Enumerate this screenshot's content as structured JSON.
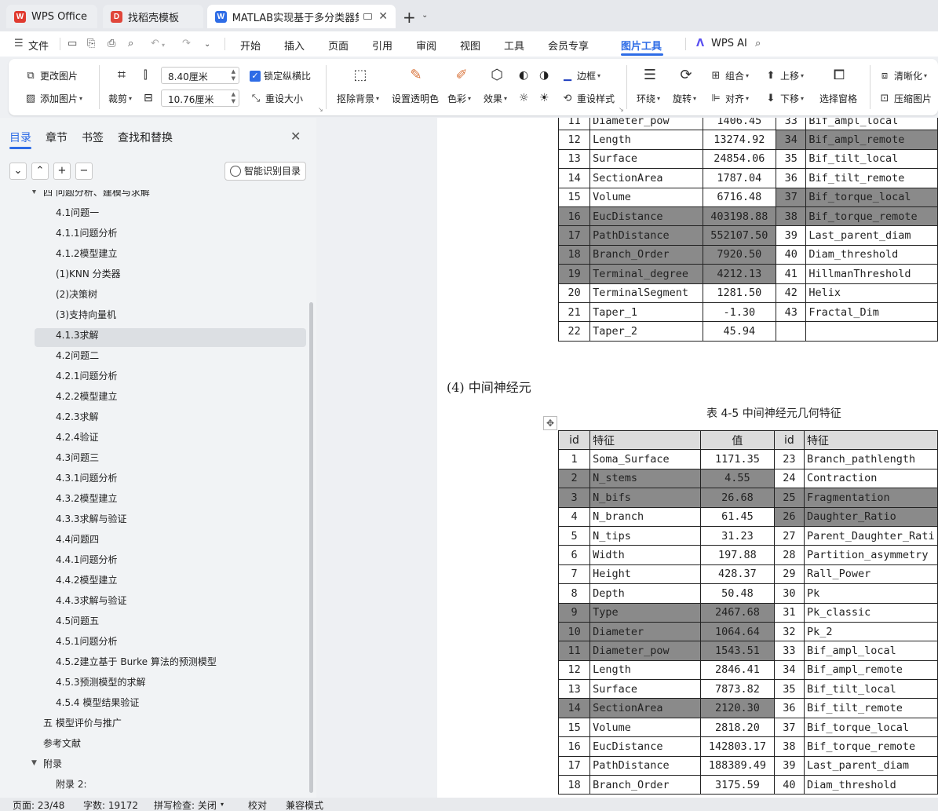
{
  "tabs": [
    {
      "label": "WPS Office"
    },
    {
      "label": "找稻壳模板"
    },
    {
      "label": "MATLAB实现基于多分类器集成"
    }
  ],
  "menu": {
    "file": "文件",
    "items": [
      "开始",
      "插入",
      "页面",
      "引用",
      "审阅",
      "视图",
      "工具",
      "会员专享",
      "图片工具"
    ],
    "wps_ai": "WPS AI"
  },
  "ribbon": {
    "change_image": "更改图片",
    "add_image": "添加图片",
    "crop": "裁剪",
    "width_value": "8.40厘米",
    "height_value": "10.76厘米",
    "lock_ratio": "锁定纵横比",
    "reset_size": "重设大小",
    "remove_bg": "抠除背景",
    "set_transparent": "设置透明色",
    "color": "色彩",
    "effect": "效果",
    "border": "边框",
    "reset_style": "重设样式",
    "wrap": "环绕",
    "rotate": "旋转",
    "group": "组合",
    "align": "对齐",
    "move_up": "上移",
    "move_down": "下移",
    "selection_pane": "选择窗格",
    "sharpen": "清晰化",
    "compress": "压缩图片"
  },
  "sidebar": {
    "tabs": [
      "目录",
      "章节",
      "书签",
      "查找和替换"
    ],
    "smart_toc": "智能识别目录",
    "items": [
      {
        "label": "四 问题分析、建模与求解",
        "level": 1
      },
      {
        "label": "4.1问题一",
        "level": 2
      },
      {
        "label": "4.1.1问题分析",
        "level": 2
      },
      {
        "label": "4.1.2模型建立",
        "level": 2
      },
      {
        "label": "(1)KNN 分类器",
        "level": 2
      },
      {
        "label": "(2)决策树",
        "level": 2
      },
      {
        "label": "(3)支持向量机",
        "level": 2
      },
      {
        "label": "4.1.3求解",
        "level": 2
      },
      {
        "label": "4.2问题二",
        "level": 2
      },
      {
        "label": "4.2.1问题分析",
        "level": 2
      },
      {
        "label": "4.2.2模型建立",
        "level": 2
      },
      {
        "label": "4.2.3求解",
        "level": 2
      },
      {
        "label": "4.2.4验证",
        "level": 2
      },
      {
        "label": "4.3问题三",
        "level": 2
      },
      {
        "label": "4.3.1问题分析",
        "level": 2
      },
      {
        "label": "4.3.2模型建立",
        "level": 2
      },
      {
        "label": "4.3.3求解与验证",
        "level": 2
      },
      {
        "label": "4.4问题四",
        "level": 2
      },
      {
        "label": "4.4.1问题分析",
        "level": 2
      },
      {
        "label": "4.4.2模型建立",
        "level": 2
      },
      {
        "label": "4.4.3求解与验证",
        "level": 2
      },
      {
        "label": "4.5问题五",
        "level": 2
      },
      {
        "label": "4.5.1问题分析",
        "level": 2
      },
      {
        "label": "4.5.2建立基于 Burke 算法的预测模型",
        "level": 2
      },
      {
        "label": "4.5.3预测模型的求解",
        "level": 2
      },
      {
        "label": "4.5.4 模型结果验证",
        "level": 2
      },
      {
        "label": "五 模型评价与推广",
        "level": 1
      },
      {
        "label": "参考文献",
        "level": 1
      },
      {
        "label": "附录",
        "level": 1
      },
      {
        "label": "附录 2:",
        "level": 2
      }
    ]
  },
  "document": {
    "section_heading": "(4) 中间神经元",
    "table_caption": "表 4-5 中间神经元几何特征",
    "header": {
      "id": "id",
      "feature": "特征",
      "value": "值"
    },
    "table1_rows": [
      {
        "id": "11",
        "feature": "Diameter_pow",
        "value": "1406.45",
        "id2": "33",
        "feature2": "Bif_ampl_local",
        "g1": false,
        "g2": false
      },
      {
        "id": "12",
        "feature": "Length",
        "value": "13274.92",
        "id2": "34",
        "feature2": "Bif_ampl_remote",
        "g1": false,
        "g2": true
      },
      {
        "id": "13",
        "feature": "Surface",
        "value": "24854.06",
        "id2": "35",
        "feature2": "Bif_tilt_local",
        "g1": false,
        "g2": false
      },
      {
        "id": "14",
        "feature": "SectionArea",
        "value": "1787.04",
        "id2": "36",
        "feature2": "Bif_tilt_remote",
        "g1": false,
        "g2": false
      },
      {
        "id": "15",
        "feature": "Volume",
        "value": "6716.48",
        "id2": "37",
        "feature2": "Bif_torque_local",
        "g1": false,
        "g2": true
      },
      {
        "id": "16",
        "feature": "EucDistance",
        "value": "403198.88",
        "id2": "38",
        "feature2": "Bif_torque_remote",
        "g1": true,
        "g2": true
      },
      {
        "id": "17",
        "feature": "PathDistance",
        "value": "552107.50",
        "id2": "39",
        "feature2": "Last_parent_diam",
        "g1": true,
        "g2": false
      },
      {
        "id": "18",
        "feature": "Branch_Order",
        "value": "7920.50",
        "id2": "40",
        "feature2": "Diam_threshold",
        "g1": true,
        "g2": false
      },
      {
        "id": "19",
        "feature": "Terminal_degree",
        "value": "4212.13",
        "id2": "41",
        "feature2": "HillmanThreshold",
        "g1": true,
        "g2": false
      },
      {
        "id": "20",
        "feature": "TerminalSegment",
        "value": "1281.50",
        "id2": "42",
        "feature2": "Helix",
        "g1": false,
        "g2": false
      },
      {
        "id": "21",
        "feature": "Taper_1",
        "value": "-1.30",
        "id2": "43",
        "feature2": "Fractal_Dim",
        "g1": false,
        "g2": false
      },
      {
        "id": "22",
        "feature": "Taper_2",
        "value": "45.94",
        "id2": "",
        "feature2": "",
        "g1": false,
        "g2": false
      }
    ],
    "table2_rows": [
      {
        "id": "1",
        "feature": "Soma_Surface",
        "value": "1171.35",
        "id2": "23",
        "feature2": "Branch_pathlength",
        "g1": false,
        "g2": false
      },
      {
        "id": "2",
        "feature": "N_stems",
        "value": "4.55",
        "id2": "24",
        "feature2": "Contraction",
        "g1": true,
        "g2": false
      },
      {
        "id": "3",
        "feature": "N_bifs",
        "value": "26.68",
        "id2": "25",
        "feature2": "Fragmentation",
        "g1": true,
        "g2": true
      },
      {
        "id": "4",
        "feature": "N_branch",
        "value": "61.45",
        "id2": "26",
        "feature2": "Daughter_Ratio",
        "g1": false,
        "g2": true
      },
      {
        "id": "5",
        "feature": "N_tips",
        "value": "31.23",
        "id2": "27",
        "feature2": "Parent_Daughter_Rati",
        "g1": false,
        "g2": false
      },
      {
        "id": "6",
        "feature": "Width",
        "value": "197.88",
        "id2": "28",
        "feature2": "Partition_asymmetry",
        "g1": false,
        "g2": false
      },
      {
        "id": "7",
        "feature": "Height",
        "value": "428.37",
        "id2": "29",
        "feature2": "Rall_Power",
        "g1": false,
        "g2": false
      },
      {
        "id": "8",
        "feature": "Depth",
        "value": "50.48",
        "id2": "30",
        "feature2": "Pk",
        "g1": false,
        "g2": false
      },
      {
        "id": "9",
        "feature": "Type",
        "value": "2467.68",
        "id2": "31",
        "feature2": "Pk_classic",
        "g1": true,
        "g2": false
      },
      {
        "id": "10",
        "feature": "Diameter",
        "value": "1064.64",
        "id2": "32",
        "feature2": "Pk_2",
        "g1": true,
        "g2": false
      },
      {
        "id": "11",
        "feature": "Diameter_pow",
        "value": "1543.51",
        "id2": "33",
        "feature2": "Bif_ampl_local",
        "g1": true,
        "g2": false
      },
      {
        "id": "12",
        "feature": "Length",
        "value": "2846.41",
        "id2": "34",
        "feature2": "Bif_ampl_remote",
        "g1": false,
        "g2": false
      },
      {
        "id": "13",
        "feature": "Surface",
        "value": "7873.82",
        "id2": "35",
        "feature2": "Bif_tilt_local",
        "g1": false,
        "g2": false
      },
      {
        "id": "14",
        "feature": "SectionArea",
        "value": "2120.30",
        "id2": "36",
        "feature2": "Bif_tilt_remote",
        "g1": true,
        "g2": false
      },
      {
        "id": "15",
        "feature": "Volume",
        "value": "2818.20",
        "id2": "37",
        "feature2": "Bif_torque_local",
        "g1": false,
        "g2": false
      },
      {
        "id": "16",
        "feature": "EucDistance",
        "value": "142803.17",
        "id2": "38",
        "feature2": "Bif_torque_remote",
        "g1": false,
        "g2": false
      },
      {
        "id": "17",
        "feature": "PathDistance",
        "value": "188389.49",
        "id2": "39",
        "feature2": "Last_parent_diam",
        "g1": false,
        "g2": false
      },
      {
        "id": "18",
        "feature": "Branch_Order",
        "value": "3175.59",
        "id2": "40",
        "feature2": "Diam_threshold",
        "g1": false,
        "g2": false
      }
    ]
  },
  "status": {
    "page": "页面: 23/48",
    "words": "字数: 19172",
    "spell": "拼写检查: 关闭",
    "proof": "校对",
    "compat": "兼容模式"
  },
  "colors": {
    "accent": "#2e6ce6",
    "highlight_cell": "#8a8a8a",
    "wps_red": "#e03a2f"
  }
}
